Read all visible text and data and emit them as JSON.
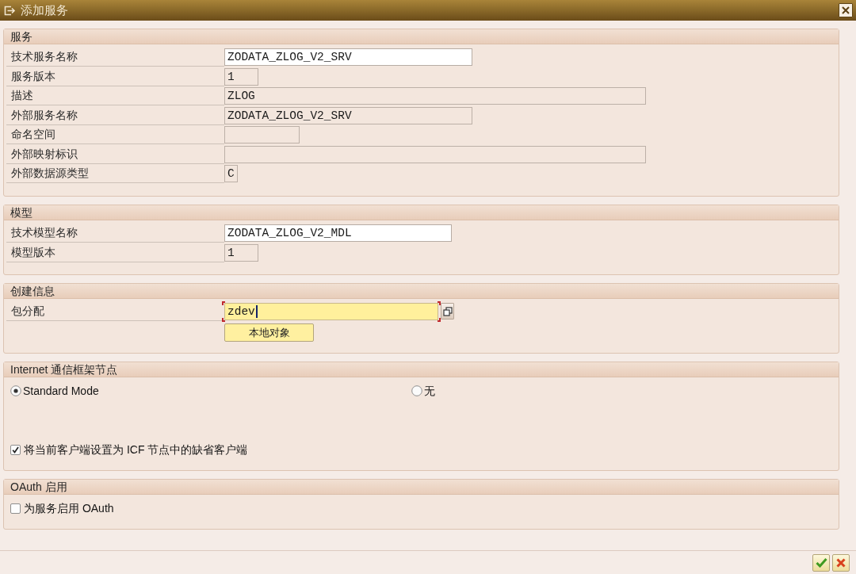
{
  "window": {
    "title": "添加服务"
  },
  "sections": [
    {
      "title": "服务",
      "kind": "form",
      "fields": [
        {
          "label": "技术服务名称",
          "value": "ZODATA_ZLOG_V2_SRV",
          "editable": true,
          "focused": false
        },
        {
          "label": "服务版本",
          "value": "1",
          "editable": false,
          "focused": false
        },
        {
          "label": "描述",
          "value": "ZLOG",
          "editable": false,
          "focused": false
        },
        {
          "label": "外部服务名称",
          "value": "ZODATA_ZLOG_V2_SRV",
          "editable": false,
          "focused": false
        },
        {
          "label": "命名空间",
          "editable": false,
          "focused": false
        },
        {
          "label": "外部映射标识",
          "editable": false,
          "focused": false
        },
        {
          "label": "外部数据源类型",
          "value": "C",
          "editable": false,
          "focused": false
        }
      ]
    },
    {
      "title": "模型",
      "kind": "form",
      "fields": [
        {
          "label": "技术模型名称",
          "value": "ZODATA_ZLOG_V2_MDL",
          "editable": true,
          "focused": false
        },
        {
          "label": "模型版本",
          "value": "1",
          "editable": false,
          "focused": false
        }
      ]
    },
    {
      "title": "创建信息",
      "kind": "form",
      "fields": [
        {
          "label": "包分配",
          "value": "zdev",
          "editable": true,
          "focused": true,
          "value_help": true,
          "suggestion": "本地对象"
        }
      ]
    },
    {
      "title": "Internet 通信框架节点",
      "kind": "options",
      "radios": [
        {
          "label": "Standard Mode",
          "selected": true
        },
        {
          "label": "无",
          "selected": false
        }
      ],
      "checkboxes": [
        {
          "label": "将当前客户端设置为 ICF 节点中的缺省客户端",
          "checked": true
        }
      ]
    },
    {
      "title": "OAuth 启用",
      "kind": "options",
      "checkboxes": [
        {
          "label": "为服务启用 OAuth",
          "checked": false
        }
      ]
    }
  ],
  "footer": {
    "buttons": [
      {
        "kind": "confirm"
      },
      {
        "kind": "cancel"
      }
    ]
  }
}
